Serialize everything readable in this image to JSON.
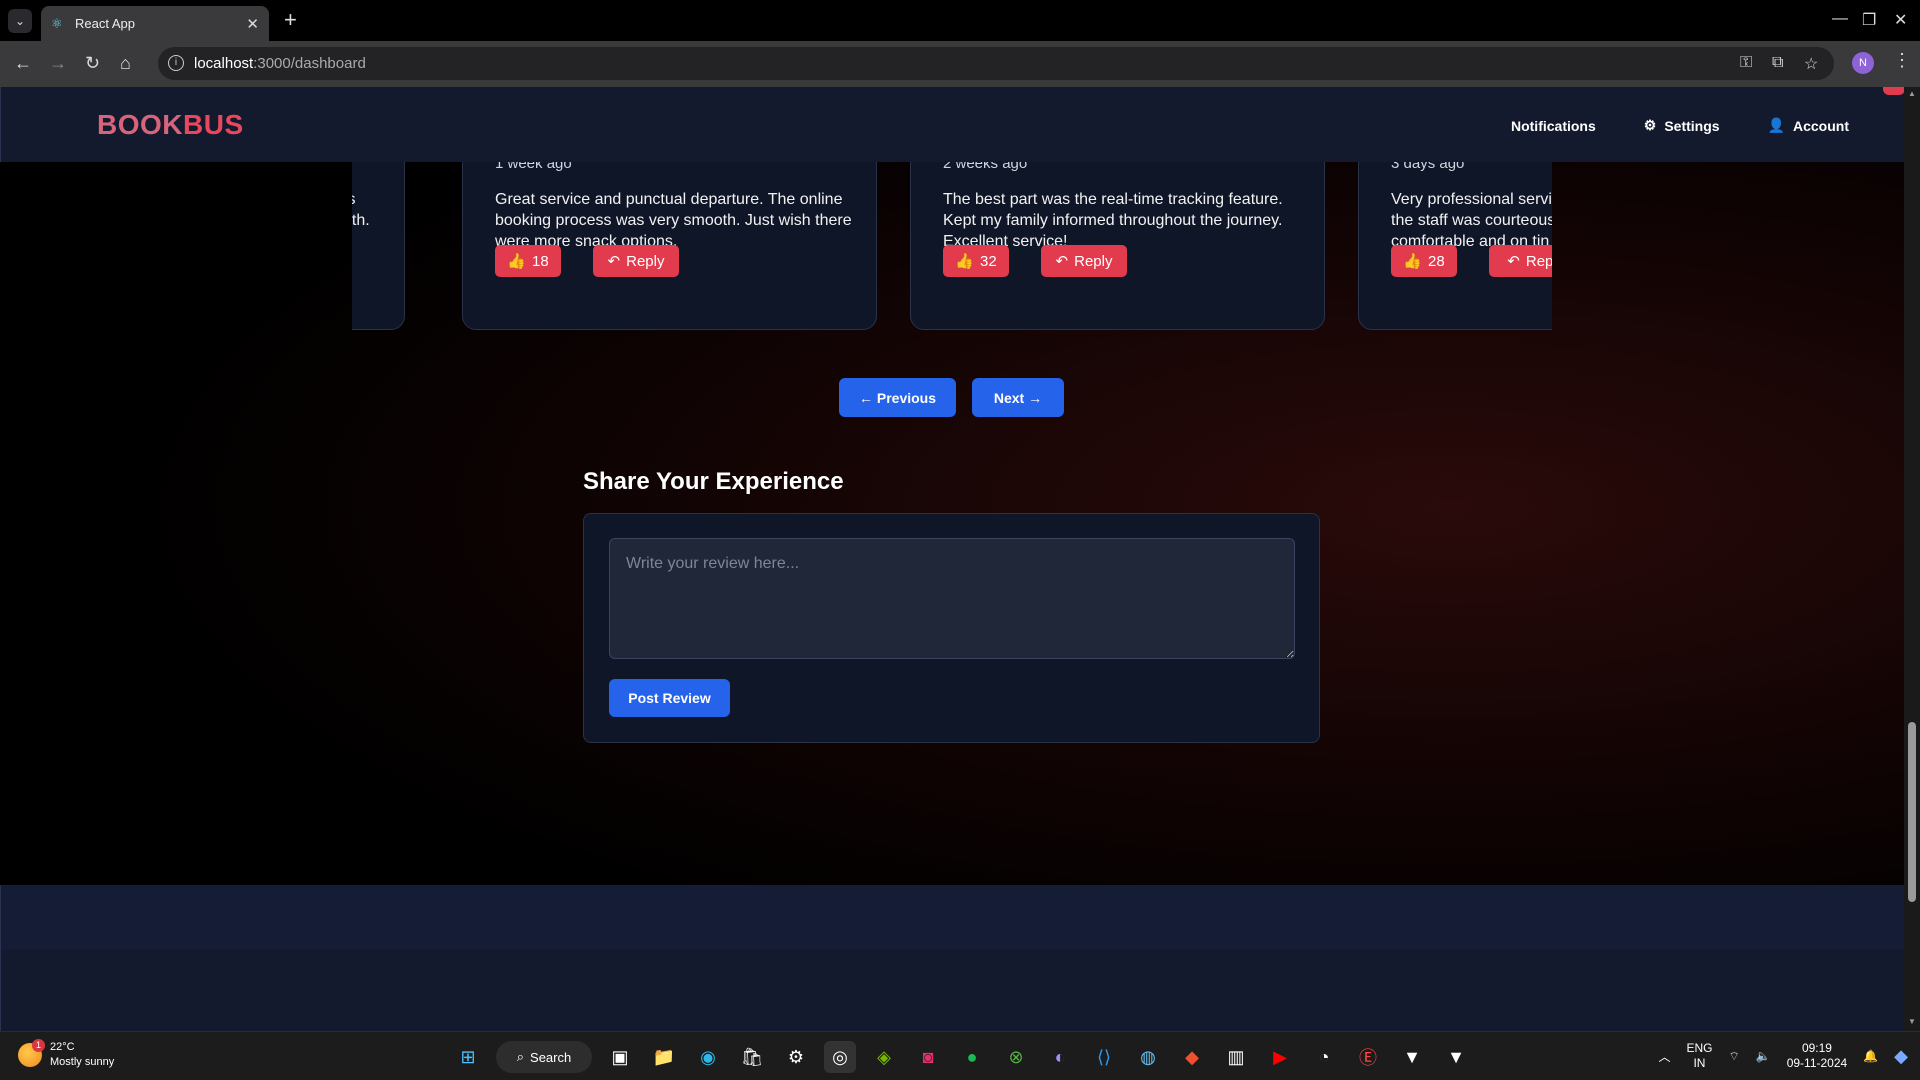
{
  "browser": {
    "tab_title": "React App",
    "url_host": "localhost",
    "url_path": ":3000/dashboard",
    "profile_initial": "N"
  },
  "app": {
    "logo_part1": "BOOK",
    "logo_part2": "BUS",
    "nav": {
      "notifications": "Notifications",
      "settings": "Settings",
      "account": "Account"
    }
  },
  "reviews": [
    {
      "ago": "",
      "text": "ts\noth.",
      "likes": "",
      "reply": ""
    },
    {
      "ago": "1 week ago",
      "text": "Great service and punctual departure. The online booking process was very smooth. Just wish there were more snack options.",
      "likes": "18",
      "reply": "Reply"
    },
    {
      "ago": "2 weeks ago",
      "text": "The best part was the real-time tracking feature. Kept my family informed throughout the journey. Excellent service!",
      "likes": "32",
      "reply": "Reply"
    },
    {
      "ago": "3 days ago",
      "text": "Very professional servic the staff was courteous comfortable and on tin",
      "likes": "28",
      "reply": "Repl"
    }
  ],
  "pagination": {
    "previous": "← Previous",
    "next": "Next →"
  },
  "share": {
    "title": "Share Your Experience",
    "placeholder": "Write your review here...",
    "post_button": "Post Review"
  },
  "taskbar": {
    "temp": "22°C",
    "weather": "Mostly sunny",
    "weather_badge": "1",
    "search": "Search",
    "lang1": "ENG",
    "lang2": "IN",
    "time": "09:19",
    "date": "09-11-2024"
  }
}
